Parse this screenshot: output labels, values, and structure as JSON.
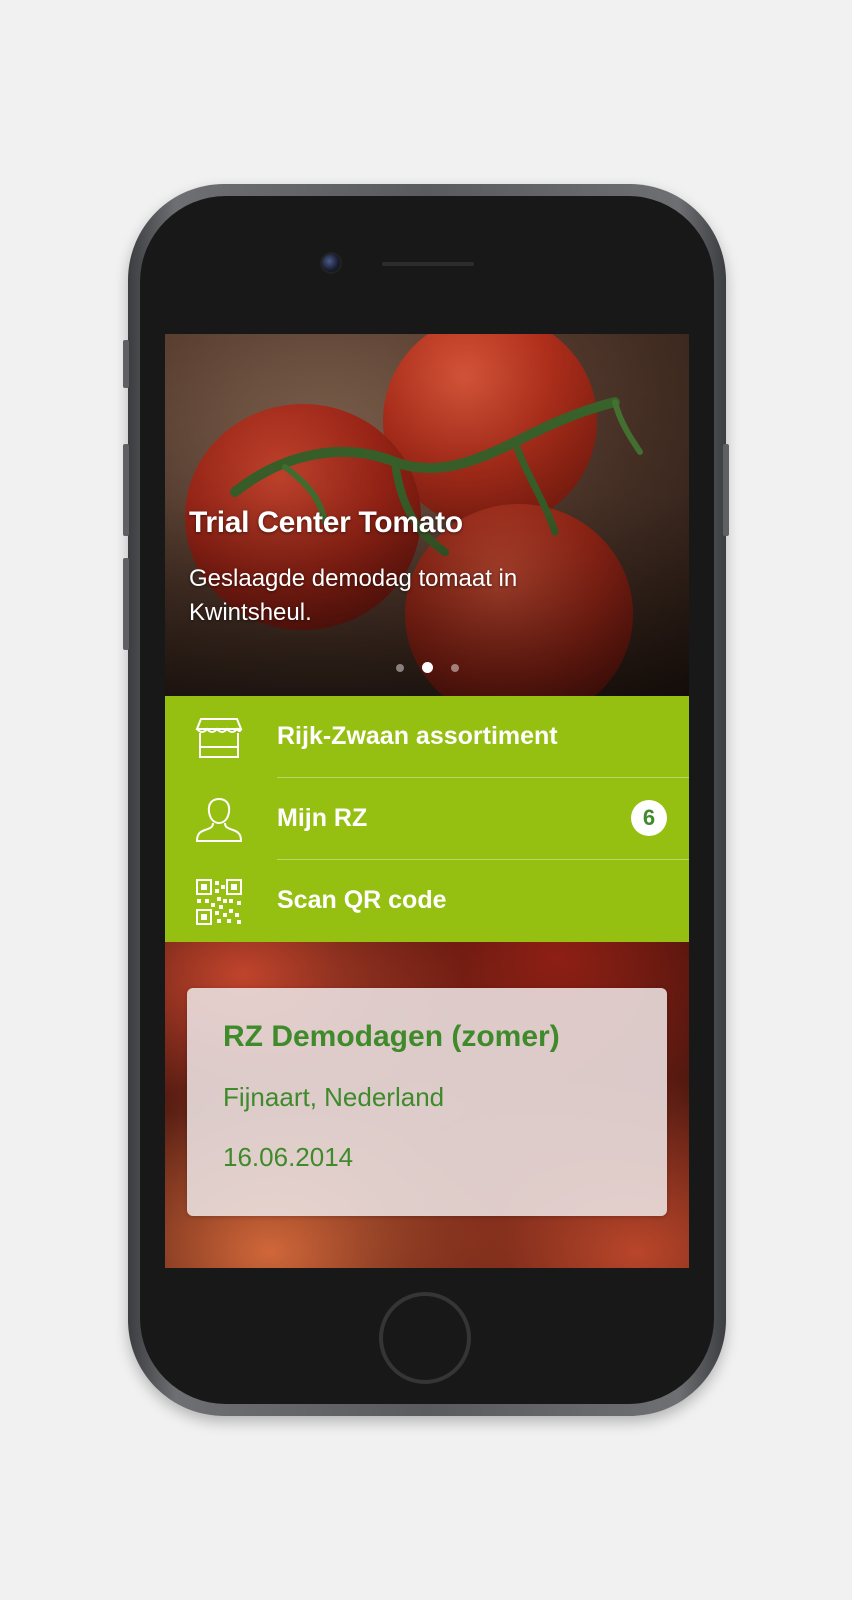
{
  "hero": {
    "title": "Trial Center Tomato",
    "subtitle": "Geslaagde demodag tomaat in Kwintsheul.",
    "slides_total": 3,
    "active_slide": 2
  },
  "menu": {
    "items": [
      {
        "label": "Rijk-Zwaan assortiment",
        "icon": "shop-icon"
      },
      {
        "label": "Mijn RZ",
        "icon": "user-icon",
        "badge": "6"
      },
      {
        "label": "Scan QR code",
        "icon": "qr-code-icon"
      }
    ]
  },
  "event": {
    "title": "RZ Demodagen (zomer)",
    "location": "Fijnaart, Nederland",
    "date": "16.06.2014"
  },
  "colors": {
    "brand_green": "#96c011",
    "text_green": "#3f8a2b",
    "background": "#f1f1f1",
    "phone_body": "#181818"
  }
}
